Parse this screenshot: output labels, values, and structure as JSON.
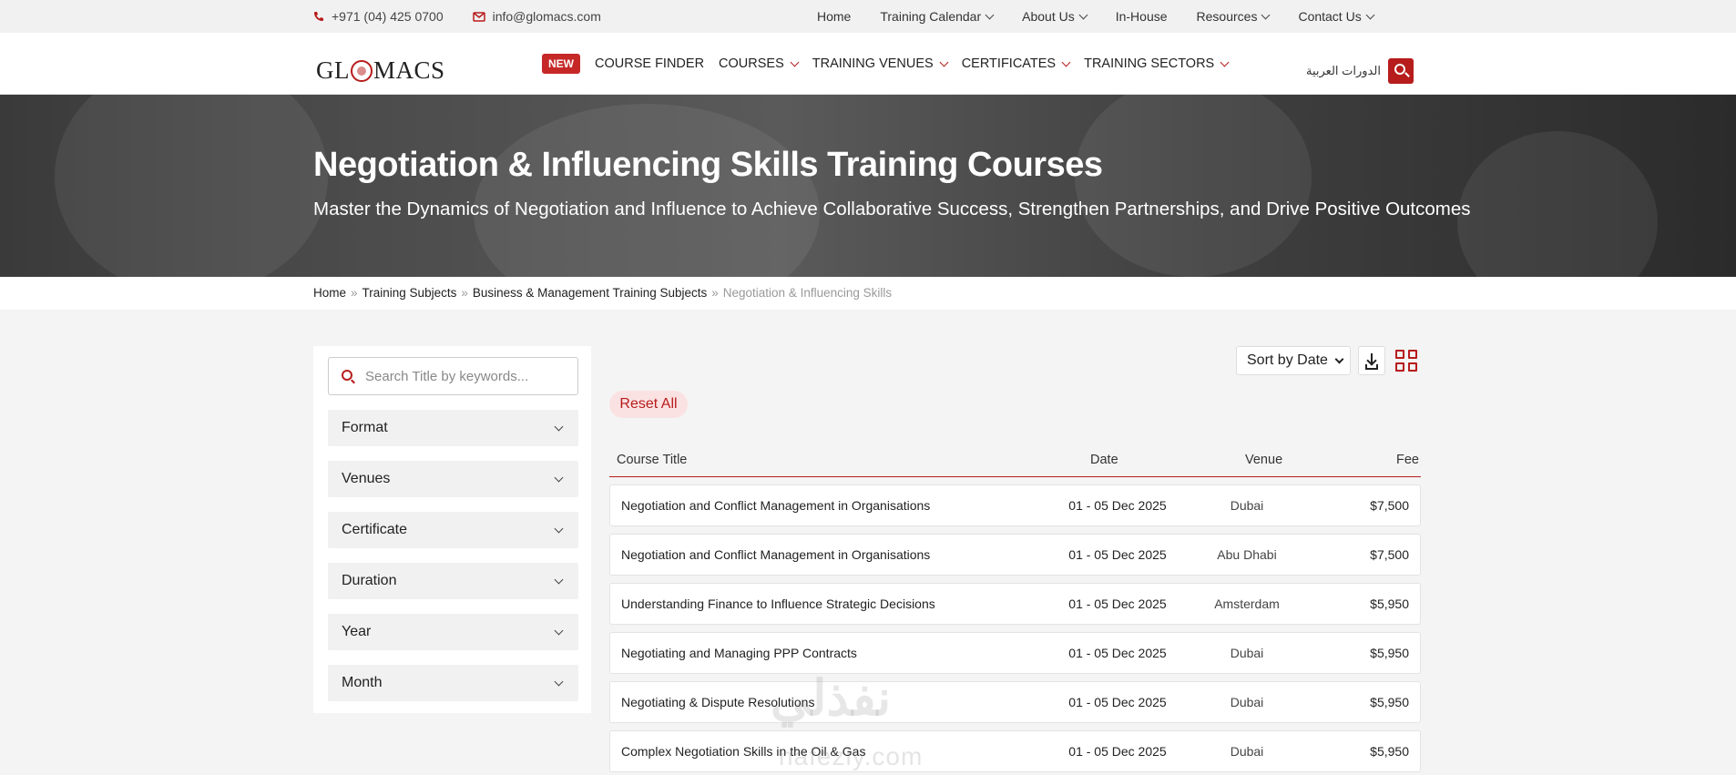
{
  "topbar": {
    "phone": "+971 (04) 425 0700",
    "email": "info@glomacs.com",
    "links": [
      {
        "label": "Home",
        "dropdown": false
      },
      {
        "label": "Training Calendar",
        "dropdown": true
      },
      {
        "label": "About Us",
        "dropdown": true
      },
      {
        "label": "In-House",
        "dropdown": false
      },
      {
        "label": "Resources",
        "dropdown": true
      },
      {
        "label": "Contact Us",
        "dropdown": true
      }
    ]
  },
  "header": {
    "logo": {
      "before": "GL",
      "after": "MACS"
    },
    "badge": "NEW",
    "nav": [
      {
        "label": "COURSE FINDER",
        "dropdown": false
      },
      {
        "label": "COURSES",
        "dropdown": true
      },
      {
        "label": "TRAINING VENUES",
        "dropdown": true
      },
      {
        "label": "CERTIFICATES",
        "dropdown": true
      },
      {
        "label": "TRAINING SECTORS",
        "dropdown": true
      }
    ],
    "arabic_link": "الدورات العربية"
  },
  "hero": {
    "title": "Negotiation & Influencing Skills Training Courses",
    "subtitle": "Master the Dynamics of Negotiation and Influence to Achieve Collaborative Success, Strengthen Partnerships, and Drive Positive Outcomes"
  },
  "breadcrumb": {
    "items": [
      "Home",
      "Training Subjects",
      "Business & Management Training Subjects"
    ],
    "current": "Negotiation & Influencing Skills"
  },
  "sidebar": {
    "search_placeholder": "Search Title by keywords...",
    "filters": [
      "Format",
      "Venues",
      "Certificate",
      "Duration",
      "Year",
      "Month"
    ]
  },
  "toolbar": {
    "sort_label": "Sort by Date",
    "reset_label": "Reset All"
  },
  "table": {
    "headers": {
      "title": "Course Title",
      "date": "Date",
      "venue": "Venue",
      "fee": "Fee"
    },
    "rows": [
      {
        "title": "Negotiation and Conflict Management in Organisations",
        "date": "01 - 05 Dec 2025",
        "venue": "Dubai",
        "fee": "$7,500"
      },
      {
        "title": "Negotiation and Conflict Management in Organisations",
        "date": "01 - 05 Dec 2025",
        "venue": "Abu Dhabi",
        "fee": "$7,500"
      },
      {
        "title": "Understanding Finance to Influence Strategic Decisions",
        "date": "01 - 05 Dec 2025",
        "venue": "Amsterdam",
        "fee": "$5,950"
      },
      {
        "title": "Negotiating and Managing PPP Contracts",
        "date": "01 - 05 Dec 2025",
        "venue": "Dubai",
        "fee": "$5,950"
      },
      {
        "title": "Negotiating & Dispute Resolutions",
        "date": "01 - 05 Dec 2025",
        "venue": "Dubai",
        "fee": "$5,950"
      },
      {
        "title": "Complex Negotiation Skills in the Oil & Gas",
        "date": "01 - 05 Dec 2025",
        "venue": "Dubai",
        "fee": "$5,950"
      }
    ]
  },
  "watermark": {
    "arabic": "نفذلي",
    "latin": "nafezly.com"
  },
  "colors": {
    "accent": "#b71c1c",
    "badge": "#c62828",
    "reset_bg": "#fbe2e2"
  },
  "icons": {
    "phone": "phone-icon",
    "email": "mail-icon",
    "search": "search-icon",
    "download": "download-icon",
    "grid": "grid-view-icon"
  }
}
